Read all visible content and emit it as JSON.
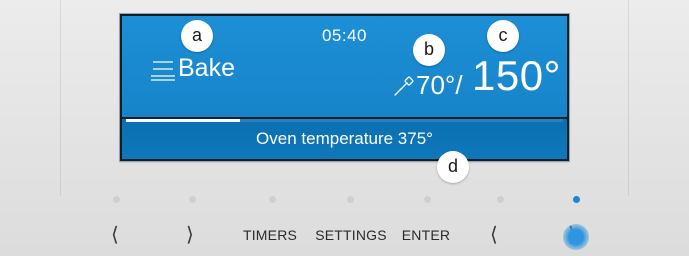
{
  "display": {
    "clock": "05:40",
    "mode_label": "Bake",
    "probe_temp": "70°/",
    "oven_temp": "150°",
    "status_text": "Oven temperature 375°",
    "progress_fraction": 0.26
  },
  "callouts": {
    "a": "a",
    "b": "b",
    "c": "c",
    "d": "d"
  },
  "buttons": {
    "left_1": "⟨",
    "right_1": "⟩",
    "timers": "TIMERS",
    "settings": "SETTINGS",
    "enter": "ENTER",
    "left_2": "⟨",
    "right_2": "⟩"
  },
  "colors": {
    "display_blue": "#1d8fd6",
    "status_bar_blue": "#0b6fb0",
    "active_dot": "#1a86d2"
  },
  "icons": {
    "mode": "bake-lines-icon",
    "probe": "temperature-probe-icon"
  }
}
